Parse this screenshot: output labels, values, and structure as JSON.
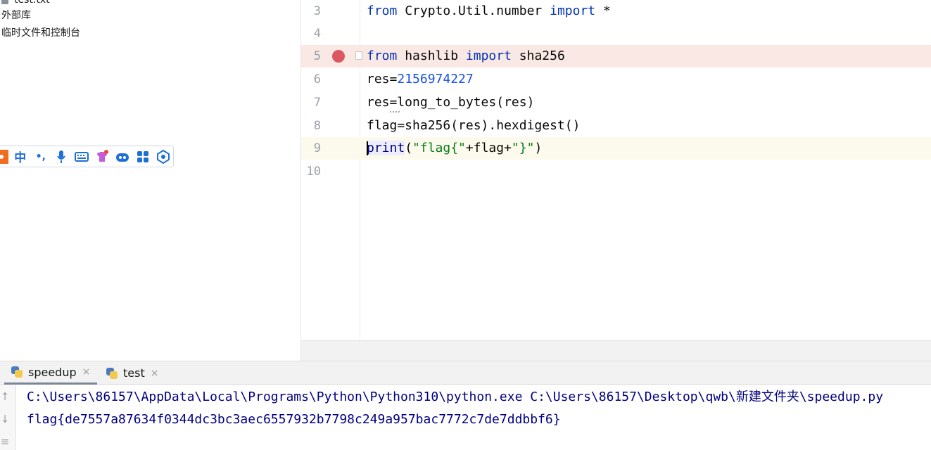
{
  "project": {
    "items": [
      {
        "label": "test.txt",
        "icon": "text-file-icon"
      },
      {
        "label": "外部库"
      },
      {
        "label": "临时文件和控制台"
      }
    ]
  },
  "ime_toolbar": {
    "mode_label": "中",
    "punct_label": "•,",
    "icons": [
      "logo-icon",
      "chinese-mode-icon",
      "punctuation-icon",
      "microphone-icon",
      "keyboard-icon",
      "skin-icon",
      "robot-icon",
      "apps-grid-icon",
      "toolbox-icon"
    ]
  },
  "editor": {
    "lines": [
      {
        "num": "3",
        "tokens": [
          {
            "t": "from",
            "c": "kw"
          },
          {
            "t": " Crypto.Util.number "
          },
          {
            "t": "import",
            "c": "kw"
          },
          {
            "t": " *"
          }
        ]
      },
      {
        "num": "4",
        "tokens": []
      },
      {
        "num": "5",
        "tokens": [
          {
            "t": "from",
            "c": "kw"
          },
          {
            "t": " hashlib "
          },
          {
            "t": "import",
            "c": "kw"
          },
          {
            "t": " sha256"
          }
        ],
        "breakpoint": true
      },
      {
        "num": "6",
        "tokens": [
          {
            "t": "res="
          },
          {
            "t": "2156974227",
            "c": "num"
          }
        ]
      },
      {
        "num": "7",
        "tokens": [
          {
            "t": "res=long_to_bytes(res)"
          }
        ]
      },
      {
        "num": "8",
        "tokens": [
          {
            "t": "flag=sha256(res).hexdigest()"
          }
        ]
      },
      {
        "num": "9",
        "tokens": [
          {
            "t": "print",
            "c": "builtin"
          },
          {
            "t": "("
          },
          {
            "t": "\"flag{\"",
            "c": "str"
          },
          {
            "t": "+flag+"
          },
          {
            "t": "\"}\"",
            "c": "str"
          },
          {
            "t": ")"
          }
        ],
        "current": true
      },
      {
        "num": "10",
        "tokens": []
      }
    ],
    "colors": {
      "keyword": "#0033b3",
      "number": "#1750eb",
      "string": "#067d17",
      "breakpoint": "#db5860"
    }
  },
  "run": {
    "tabs": [
      {
        "label": "speedup",
        "active": true
      },
      {
        "label": "test",
        "active": false
      }
    ],
    "close_glyph": "×",
    "console": {
      "lines": [
        "C:\\Users\\86157\\AppData\\Local\\Programs\\Python\\Python310\\python.exe C:\\Users\\86157\\Desktop\\qwb\\新建文件夹\\speedup.py",
        "flag{de7557a87634f0344dc3bc3aec6557932b7798c249a957bac7772c7de7ddbbf6}"
      ]
    },
    "toolbar_icons": [
      "scroll-up-icon",
      "scroll-down-icon",
      "soft-wrap-icon"
    ]
  }
}
